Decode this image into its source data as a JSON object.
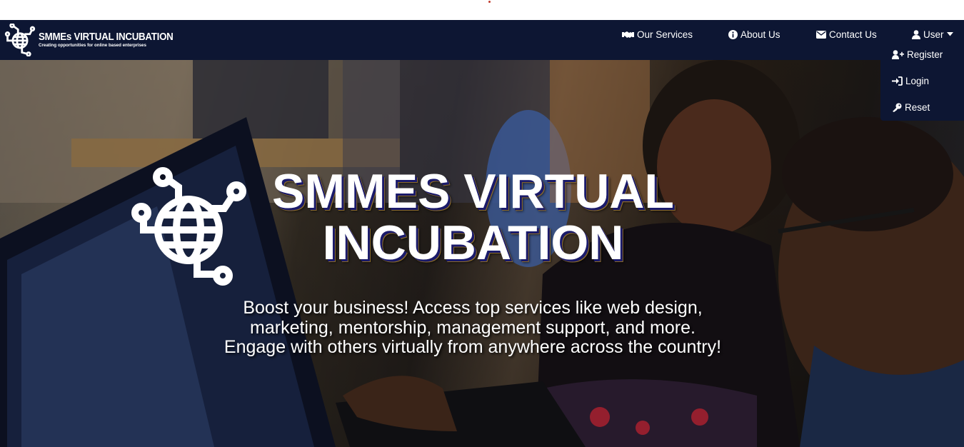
{
  "brand": {
    "title": "SMMEs VIRTUAL INCUBATION",
    "tagline": "Creating opportunities for online based enterprises",
    "logo_icon": "globe-circuit-icon"
  },
  "nav": {
    "services": {
      "label": "Our Services",
      "icon": "handshake-icon"
    },
    "about": {
      "label": "About Us",
      "icon": "info-circle-icon"
    },
    "contact": {
      "label": "Contact Us",
      "icon": "envelope-icon"
    },
    "user": {
      "label": "User",
      "icon": "user-icon",
      "caret": "caret-down-icon"
    }
  },
  "user_menu": {
    "register": {
      "label": "Register",
      "icon": "user-plus-icon"
    },
    "login": {
      "label": "Login",
      "icon": "sign-in-icon"
    },
    "reset": {
      "label": "Reset",
      "icon": "key-icon"
    }
  },
  "hero": {
    "title_line1": "SMMES VIRTUAL",
    "title_line2": "INCUBATION",
    "subtitle_line1": "Boost your business! Access top services like web design,",
    "subtitle_line2": "marketing, mentorship, management support, and more.",
    "subtitle_line3": "Engage with others virtually from anywhere across the country!"
  },
  "colors": {
    "navbar": "#0d1633",
    "text": "#ffffff"
  }
}
